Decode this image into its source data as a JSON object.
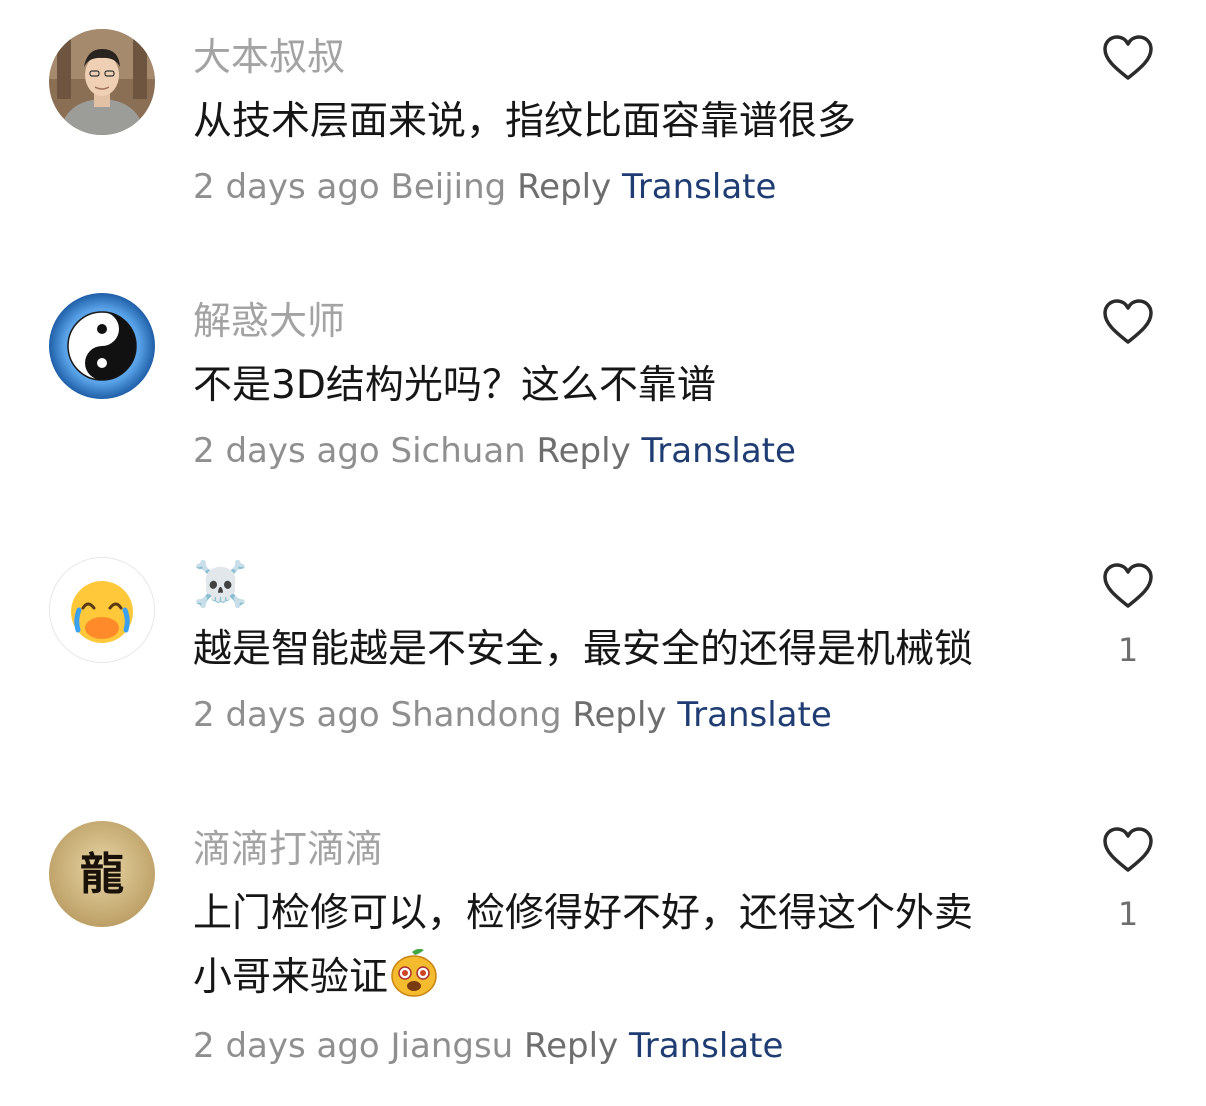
{
  "comments": [
    {
      "username": "大本叔叔",
      "text": "从技术层面来说，指纹比面容靠谱很多",
      "time": "2 days ago",
      "location": "Beijing",
      "reply_label": "Reply",
      "translate_label": "Translate",
      "likes": ""
    },
    {
      "username": "解惑大师",
      "text": "不是3D结构光吗？这么不靠谱",
      "time": "2 days ago",
      "location": "Sichuan",
      "reply_label": "Reply",
      "translate_label": "Translate",
      "likes": ""
    },
    {
      "username": "☠️",
      "text": "越是智能越是不安全，最安全的还得是机械锁",
      "time": "2 days ago",
      "location": "Shandong",
      "reply_label": "Reply",
      "translate_label": "Translate",
      "likes": "1"
    },
    {
      "username": "滴滴打滴滴",
      "text_line1": "上门检修可以，检修得好不好，还得这个外卖",
      "text_line2": "小哥来验证",
      "time": "2 days ago",
      "location": "Jiangsu",
      "reply_label": "Reply",
      "translate_label": "Translate",
      "likes": "1",
      "avatar_text": "龍"
    }
  ],
  "icons": {
    "like": "heart-outline-icon",
    "inline_emoji": "mango-face-emoji"
  },
  "colors": {
    "username": "#a3a3a3",
    "text": "#161616",
    "meta": "#8f8f8f",
    "translate": "#1f3d73"
  }
}
